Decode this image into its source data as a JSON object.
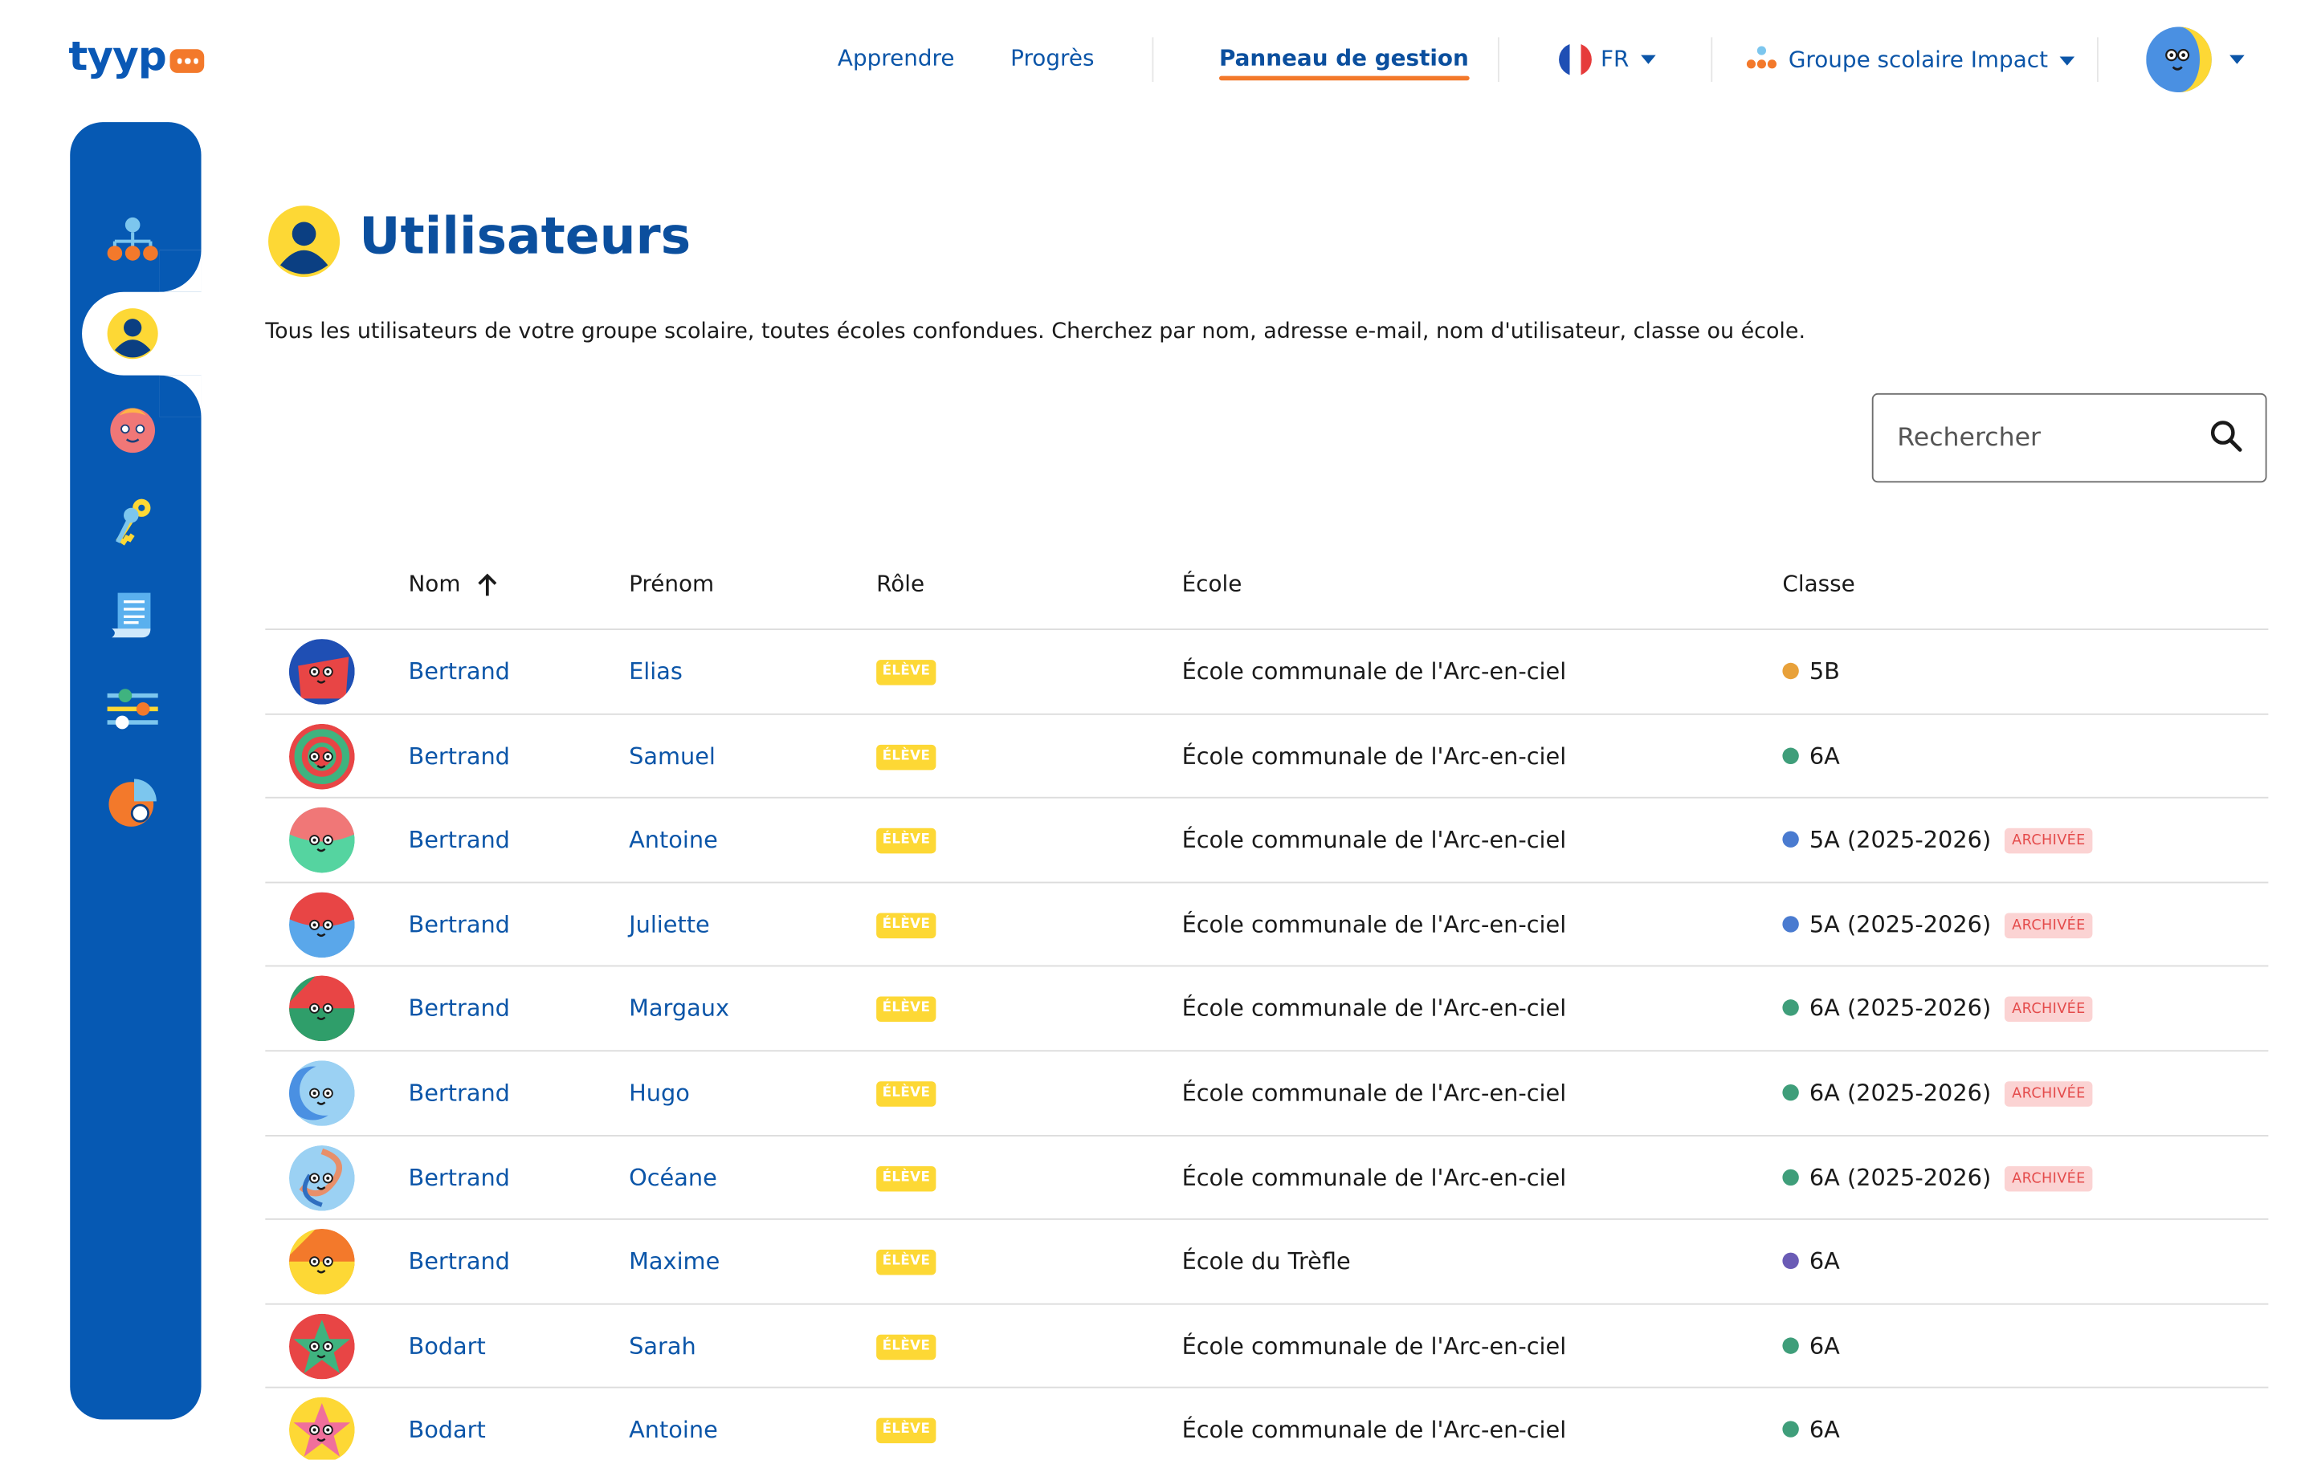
{
  "app": {
    "logo_text": "tyyp"
  },
  "topnav": {
    "learn": "Apprendre",
    "progress": "Progrès",
    "admin": "Panneau de gestion",
    "language": "FR",
    "organization": "Groupe scolaire Impact"
  },
  "page": {
    "title": "Utilisateurs",
    "description": "Tous les utilisateurs de votre groupe scolaire, toutes écoles confondues. Cherchez par nom, adresse e-mail, nom d'utilisateur, classe ou école."
  },
  "search": {
    "placeholder": "Rechercher"
  },
  "table": {
    "columns": {
      "last_name": "Nom",
      "first_name": "Prénom",
      "role": "Rôle",
      "school": "École",
      "class": "Classe"
    },
    "sort": {
      "column": "Nom",
      "direction": "ascending"
    },
    "rows": [
      {
        "last_name": "Bertrand",
        "first_name": "Elias",
        "role": "ÉLÈVE",
        "school": "École communale de l'Arc-en-ciel",
        "class": "5B",
        "class_color": "#e8a13a",
        "archived": ""
      },
      {
        "last_name": "Bertrand",
        "first_name": "Samuel",
        "role": "ÉLÈVE",
        "school": "École communale de l'Arc-en-ciel",
        "class": "6A",
        "class_color": "#3f9e7a",
        "archived": ""
      },
      {
        "last_name": "Bertrand",
        "first_name": "Antoine",
        "role": "ÉLÈVE",
        "school": "École communale de l'Arc-en-ciel",
        "class": "5A (2025-2026)",
        "class_color": "#4a7bd0",
        "archived": "ARCHIVÉE"
      },
      {
        "last_name": "Bertrand",
        "first_name": "Juliette",
        "role": "ÉLÈVE",
        "school": "École communale de l'Arc-en-ciel",
        "class": "5A (2025-2026)",
        "class_color": "#4a7bd0",
        "archived": "ARCHIVÉE"
      },
      {
        "last_name": "Bertrand",
        "first_name": "Margaux",
        "role": "ÉLÈVE",
        "school": "École communale de l'Arc-en-ciel",
        "class": "6A (2025-2026)",
        "class_color": "#3f9e7a",
        "archived": "ARCHIVÉE"
      },
      {
        "last_name": "Bertrand",
        "first_name": "Hugo",
        "role": "ÉLÈVE",
        "school": "École communale de l'Arc-en-ciel",
        "class": "6A (2025-2026)",
        "class_color": "#3f9e7a",
        "archived": "ARCHIVÉE"
      },
      {
        "last_name": "Bertrand",
        "first_name": "Océane",
        "role": "ÉLÈVE",
        "school": "École communale de l'Arc-en-ciel",
        "class": "6A (2025-2026)",
        "class_color": "#3f9e7a",
        "archived": "ARCHIVÉE"
      },
      {
        "last_name": "Bertrand",
        "first_name": "Maxime",
        "role": "ÉLÈVE",
        "school": "École du Trèfle",
        "class": "6A",
        "class_color": "#6a5bb5",
        "archived": ""
      },
      {
        "last_name": "Bodart",
        "first_name": "Sarah",
        "role": "ÉLÈVE",
        "school": "École communale de l'Arc-en-ciel",
        "class": "6A",
        "class_color": "#3f9e7a",
        "archived": ""
      },
      {
        "last_name": "Bodart",
        "first_name": "Antoine",
        "role": "ÉLÈVE",
        "school": "École communale de l'Arc-en-ciel",
        "class": "6A",
        "class_color": "#3f9e7a",
        "archived": ""
      }
    ]
  },
  "colors": {
    "brand_blue": "#0659b3",
    "link_blue": "#0b55a8",
    "accent_orange": "#f3792b",
    "role_badge_yellow": "#fdd835",
    "archived_badge_bg": "#fbd3d3",
    "archived_badge_text": "#e44b4b"
  },
  "sidebar_icons": [
    "org-chart-icon",
    "users-icon",
    "student-avatar-icon",
    "keys-icon",
    "document-icon",
    "settings-sliders-icon",
    "pie-chart-icon"
  ],
  "avatars": [
    {
      "bg": "#1f4fb4",
      "face": "#e84545",
      "shape": "split"
    },
    {
      "bg": "#e84545",
      "face": "#3fb37f",
      "shape": "ring"
    },
    {
      "bg": "#55d4a0",
      "face": "#f07777",
      "shape": "top"
    },
    {
      "bg": "#5aa7ea",
      "face": "#e84545",
      "shape": "top"
    },
    {
      "bg": "#e84545",
      "face": "#2f9e6a",
      "shape": "half"
    },
    {
      "bg": "#9bd1f3",
      "face": "#4a90e2",
      "shape": "moon"
    },
    {
      "bg": "#9bd1f3",
      "face": "#e88f6a",
      "shape": "swirl"
    },
    {
      "bg": "#f3792b",
      "face": "#fdd835",
      "shape": "half"
    },
    {
      "bg": "#e84545",
      "face": "#3fb37f",
      "shape": "star"
    },
    {
      "bg": "#fdd835",
      "face": "#f06f9b",
      "shape": "star"
    }
  ]
}
